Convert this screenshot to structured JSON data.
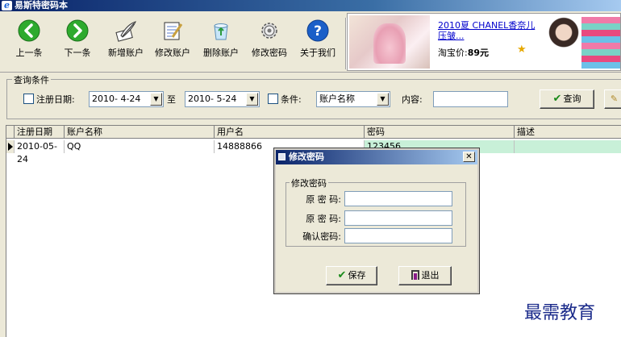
{
  "window": {
    "title": "易斯特密码本"
  },
  "toolbar": {
    "buttons": [
      {
        "label": "上一条",
        "icon": "arrow-left-icon",
        "color": "#2eaa2e"
      },
      {
        "label": "下一条",
        "icon": "arrow-right-icon",
        "color": "#2eaa2e"
      },
      {
        "label": "新增账户",
        "icon": "quill-icon"
      },
      {
        "label": "修改账户",
        "icon": "notepad-icon"
      },
      {
        "label": "删除账户",
        "icon": "recycle-bin-icon"
      },
      {
        "label": "修改密码",
        "icon": "gear-icon"
      },
      {
        "label": "关于我们",
        "icon": "help-icon",
        "color": "#1b5fc8"
      }
    ]
  },
  "ad": {
    "title": "2010夏 CHANEL香奈儿 压皱...",
    "price_label": "淘宝价:",
    "price_value": "89元"
  },
  "query": {
    "group_label": "查询条件",
    "date_checkbox_label": "注册日期:",
    "date_from": "2010- 4-24",
    "to_label": "至",
    "date_to": "2010- 5-24",
    "condition_checkbox_label": "条件:",
    "condition_value": "账户名称",
    "content_label": "内容:",
    "content_value": "",
    "search_button": "查询"
  },
  "grid": {
    "columns": [
      "注册日期",
      "账户名称",
      "用户名",
      "密码",
      "描述"
    ],
    "rows": [
      {
        "date": "2010-05-24",
        "account": "QQ",
        "username": "14888866",
        "password": "123456",
        "desc": ""
      }
    ]
  },
  "dialog": {
    "title": "修改密码",
    "group_label": "修改密码",
    "field1_label": "原 密 码:",
    "field2_label": "原 密 码:",
    "field3_label": "确认密码:",
    "field1_value": "",
    "field2_value": "",
    "field3_value": "",
    "save_button": "保存",
    "exit_button": "退出"
  },
  "watermark": "最需教育"
}
